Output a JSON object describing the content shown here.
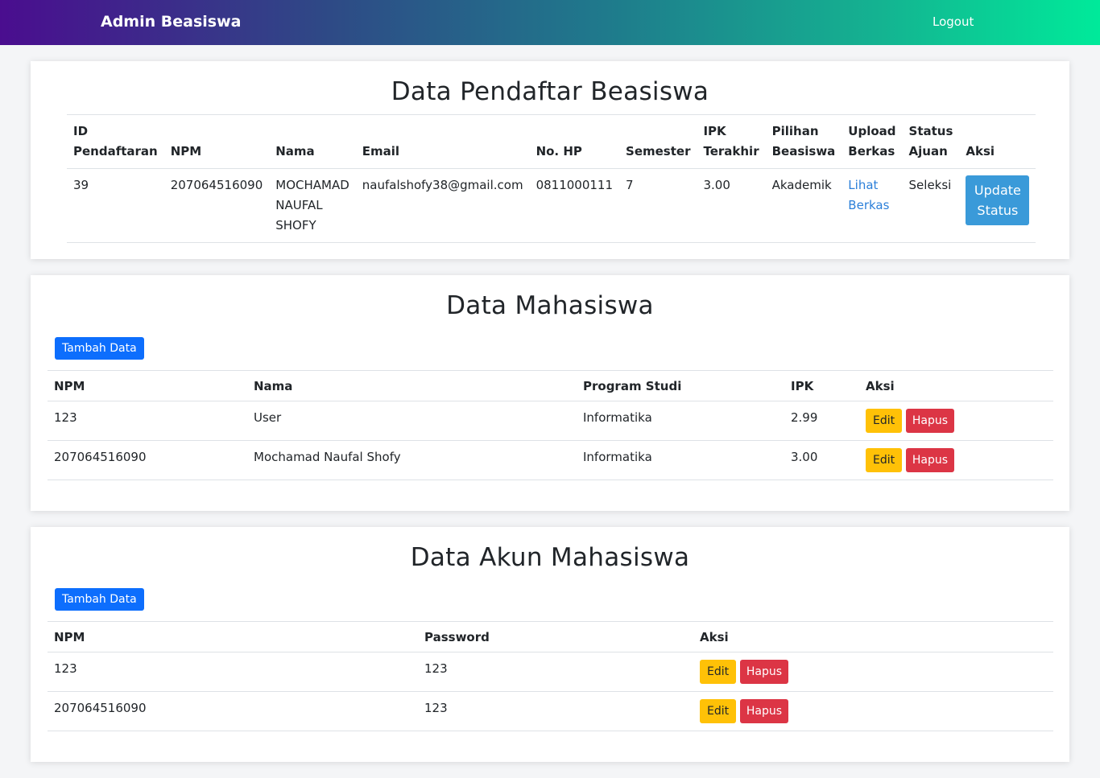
{
  "navbar": {
    "brand": "Admin Beasiswa",
    "logout": "Logout"
  },
  "pendaftar": {
    "title": "Data Pendaftar Beasiswa",
    "headers": [
      "ID Pendaftaran",
      "NPM",
      "Nama",
      "Email",
      "No. HP",
      "Semester",
      "IPK Terakhir",
      "Pilihan Beasiswa",
      "Upload Berkas",
      "Status Ajuan",
      "Aksi"
    ],
    "rows": [
      {
        "id": "39",
        "npm": "207064516090",
        "nama": "MOCHAMAD NAUFAL SHOFY",
        "email": "naufalshofy38@gmail.com",
        "hp": "0811000111",
        "semester": "7",
        "ipk": "3.00",
        "beasiswa": "Akademik",
        "berkas": "Lihat Berkas",
        "status": "Seleksi",
        "aksi": "Update Status"
      }
    ]
  },
  "mahasiswa": {
    "title": "Data Mahasiswa",
    "add_button": "Tambah Data",
    "headers": [
      "NPM",
      "Nama",
      "Program Studi",
      "IPK",
      "Aksi"
    ],
    "rows": [
      {
        "npm": "123",
        "nama": "User",
        "prodi": "Informatika",
        "ipk": "2.99",
        "edit": "Edit",
        "hapus": "Hapus"
      },
      {
        "npm": "207064516090",
        "nama": "Mochamad Naufal Shofy",
        "prodi": "Informatika",
        "ipk": "3.00",
        "edit": "Edit",
        "hapus": "Hapus"
      }
    ]
  },
  "akun": {
    "title": "Data Akun Mahasiswa",
    "add_button": "Tambah Data",
    "headers": [
      "NPM",
      "Password",
      "Aksi"
    ],
    "rows": [
      {
        "npm": "123",
        "password": "123",
        "edit": "Edit",
        "hapus": "Hapus"
      },
      {
        "npm": "207064516090",
        "password": "123",
        "edit": "Edit",
        "hapus": "Hapus"
      }
    ]
  }
}
